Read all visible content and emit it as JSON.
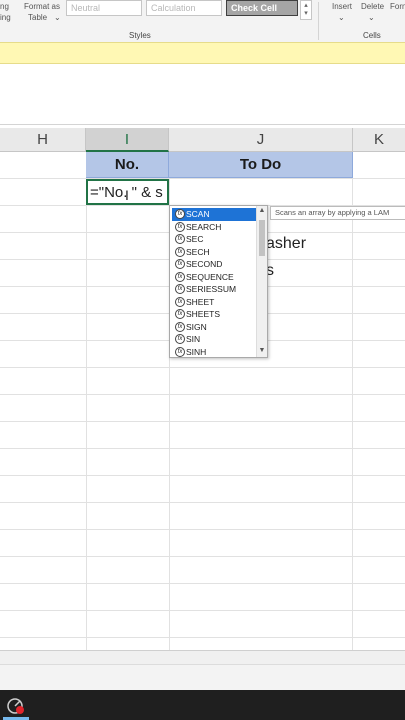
{
  "ribbon": {
    "format_as_table_line1": "Format as",
    "format_as_table_line2": "Table",
    "left_fragment_line1": "ng",
    "left_fragment_line2": "ing",
    "styles": {
      "neutral": "Neutral",
      "calculation": "Calculation",
      "check_cell": "Check Cell"
    },
    "styles_group_label": "Styles",
    "cells_group_label": "Cells",
    "insert_label": "Insert",
    "delete_label": "Delete",
    "format_label": "Forn"
  },
  "columns": [
    "H",
    "I",
    "J",
    "K"
  ],
  "selected_column": "I",
  "table": {
    "header_no": "No.",
    "header_todo": "To Do"
  },
  "cell_editor": {
    "formula_text": "=\"No. \" & s"
  },
  "partial_cells": {
    "row1_text": "asher",
    "row2_text": "s"
  },
  "autocomplete": {
    "items": [
      "SCAN",
      "SEARCH",
      "SEC",
      "SECH",
      "SECOND",
      "SEQUENCE",
      "SERIESSUM",
      "SHEET",
      "SHEETS",
      "SIGN",
      "SIN",
      "SINH"
    ],
    "selected_index": 0,
    "icon": "fx-icon"
  },
  "tooltip": {
    "text": "Scans an array by applying a LAM"
  },
  "colors": {
    "header_fill": "#b4c6e7",
    "selection_green": "#217346",
    "list_highlight": "#1e73d6",
    "notice_yellow": "#fff8b4"
  }
}
